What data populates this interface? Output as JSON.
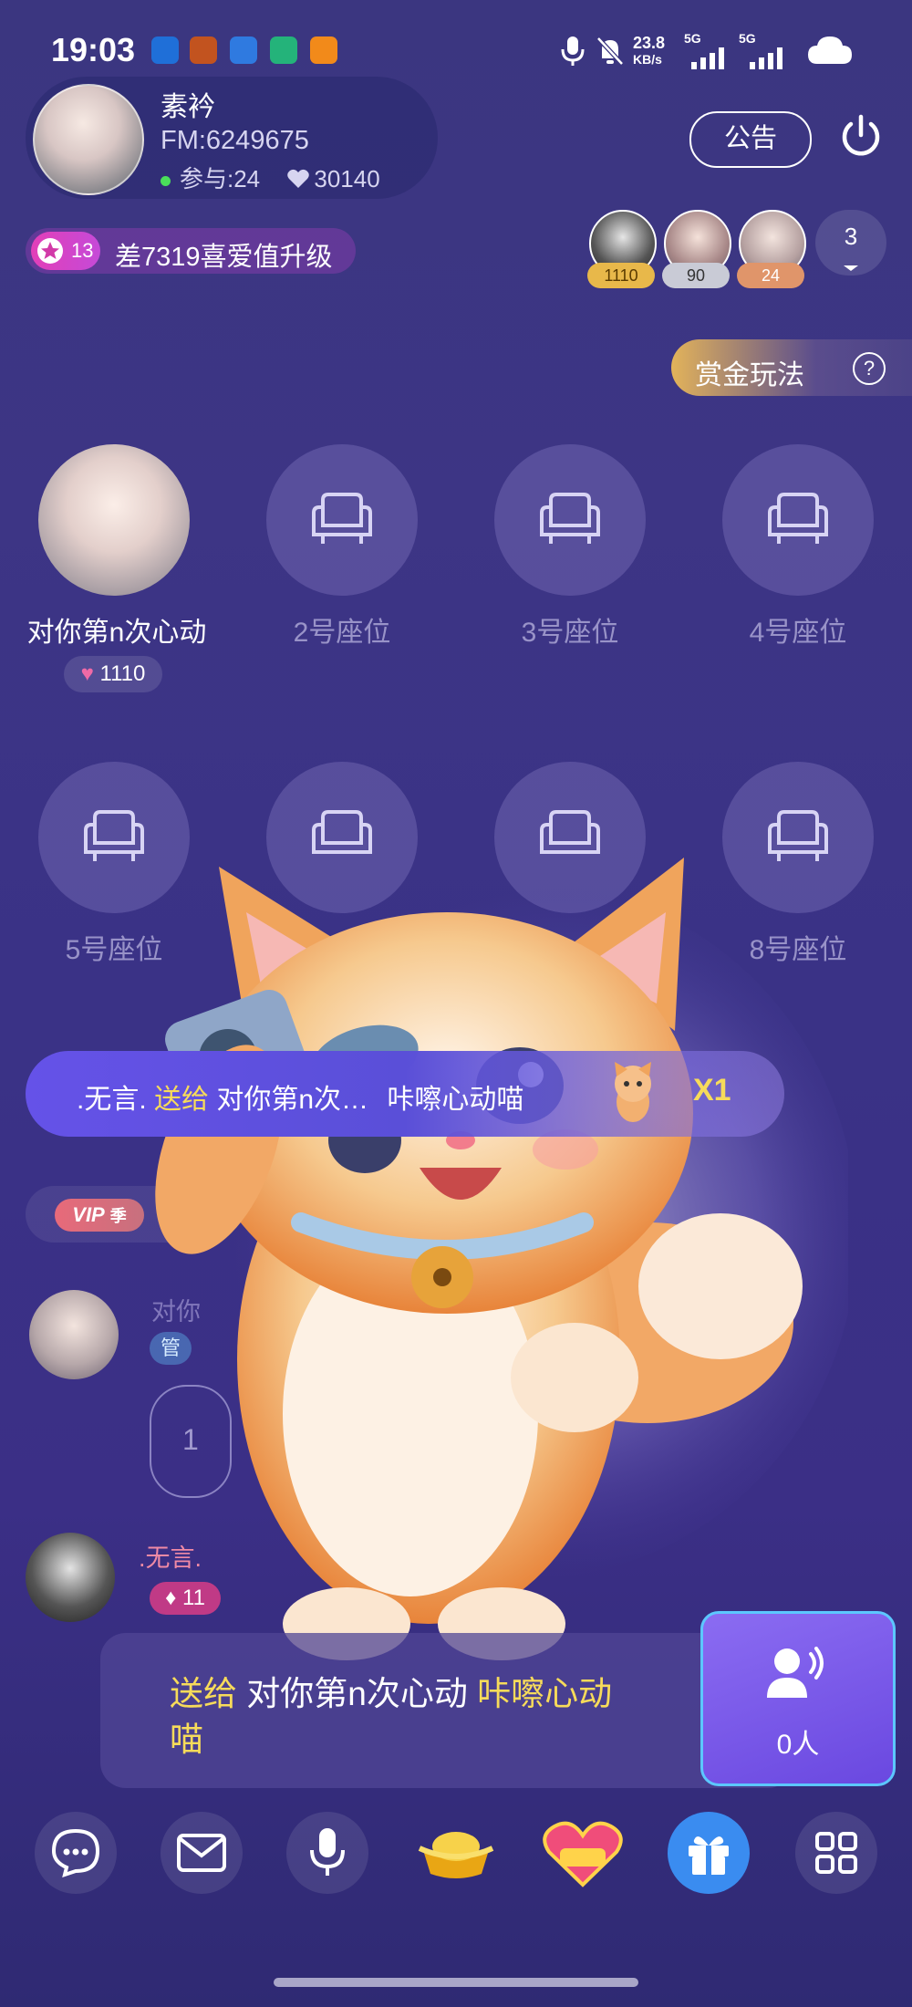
{
  "status_bar": {
    "time": "19:03",
    "net_speed": "23.8",
    "net_unit": "KB/s",
    "net1": "5G",
    "net2": "5G"
  },
  "host": {
    "name": "素衿",
    "fm_id": "FM:6249675",
    "participants": "参与:24",
    "likes": "30140"
  },
  "header": {
    "notice_label": "公告"
  },
  "level": {
    "badge": "13",
    "text": "差7319喜爱值升级"
  },
  "top_users": [
    {
      "score": "1110",
      "color": "#e8b84a"
    },
    {
      "score": "90",
      "color": "#c9cbd6"
    },
    {
      "score": "24",
      "color": "#e0956a"
    }
  ],
  "online_count": "3",
  "bounty": {
    "label": "赏金玩法",
    "help": "?"
  },
  "seats": {
    "seat1_name": "对你第n次心动",
    "seat1_likes": "1110",
    "labels": [
      "2号座位",
      "3号座位",
      "4号座位",
      "5号座位",
      "8号座位"
    ]
  },
  "gift_banner": {
    "sender": ".无言.",
    "verb": "送给",
    "receiver": "对你第n次…",
    "gift": "咔嚓心动喵",
    "count": "X1"
  },
  "messages": {
    "vip_badge": "VIP",
    "vip_season": "季",
    "m1_name": "对你",
    "m1_role": "管",
    "m1_bubble": "1",
    "m2_name": ".无言.",
    "m2_level": "11"
  },
  "chat": {
    "verb": "送给",
    "receiver": "对你第n次心动",
    "gift": "咔嚓心动",
    "gift_end": "喵"
  },
  "mic_list": {
    "count": "0人"
  },
  "colors": {
    "accent_yellow": "#f7db5a",
    "pink": "#e23fb8",
    "gift_blue": "#3a8cf0"
  }
}
